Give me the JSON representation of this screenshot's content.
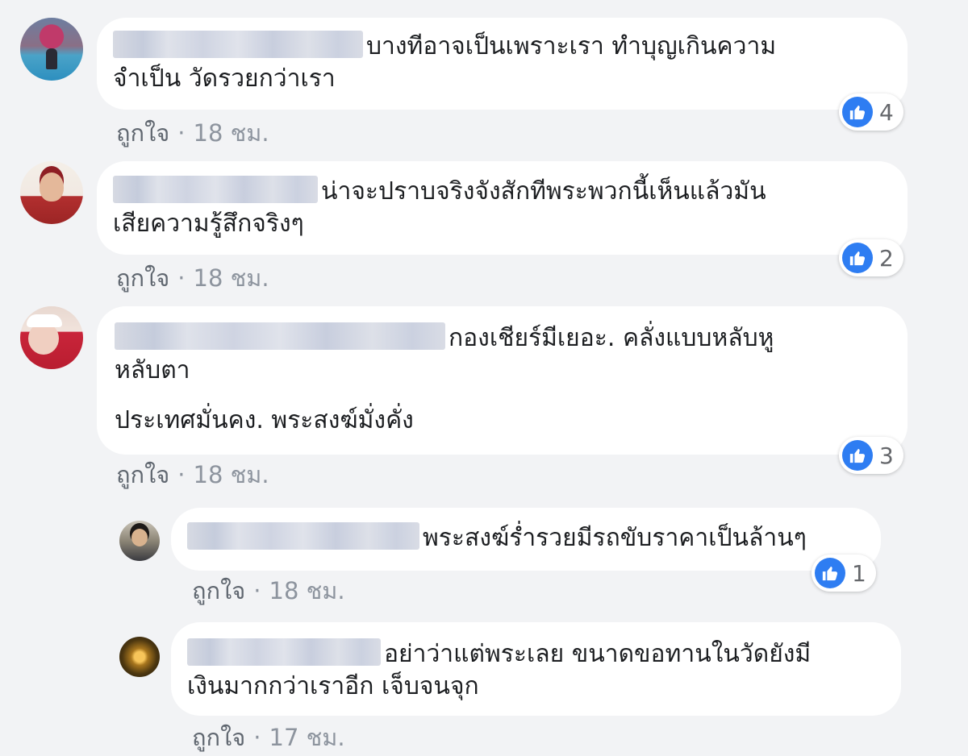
{
  "comments": [
    {
      "text_lines": [
        "บางทีอาจเป็นเพราะเรา ทำบุญเกินความ",
        "จำเป็น วัดรวยกว่าเรา"
      ],
      "like_label": "ถูกใจ",
      "separator": "·",
      "time": "18 ชม.",
      "reaction_count": "4"
    },
    {
      "text_lines": [
        "น่าจะปราบจริงจังสักทีพระพวกนี้เห็นแล้วมัน",
        "เสียความรู้สึกจริงๆ"
      ],
      "like_label": "ถูกใจ",
      "separator": "·",
      "time": "18 ชม.",
      "reaction_count": "2"
    },
    {
      "text_lines": [
        "กองเชียร์มีเยอะ. คลั่งแบบหลับหู",
        "หลับตา",
        "ประเทศมั่นคง. พระสงฆ์มั่งคั่ง"
      ],
      "like_label": "ถูกใจ",
      "separator": "·",
      "time": "18 ชม.",
      "reaction_count": "3"
    }
  ],
  "replies": [
    {
      "text_lines": [
        "พระสงฆ์ร่ำรวยมีรถขับราคาเป็นล้านๆ"
      ],
      "like_label": "ถูกใจ",
      "separator": "·",
      "time": "18 ชม.",
      "reaction_count": "1"
    },
    {
      "text_lines": [
        "อย่าว่าแต่พระเลย ขนาดขอทานในวัดยังมี",
        "เงินมากกว่าเราอีก เจ็บจนจุก"
      ],
      "like_label": "ถูกใจ",
      "separator": "·",
      "time": "17 ชม."
    }
  ],
  "icons": {
    "reaction": "thumbs-up-icon",
    "reaction_color": "#2e7df2"
  }
}
